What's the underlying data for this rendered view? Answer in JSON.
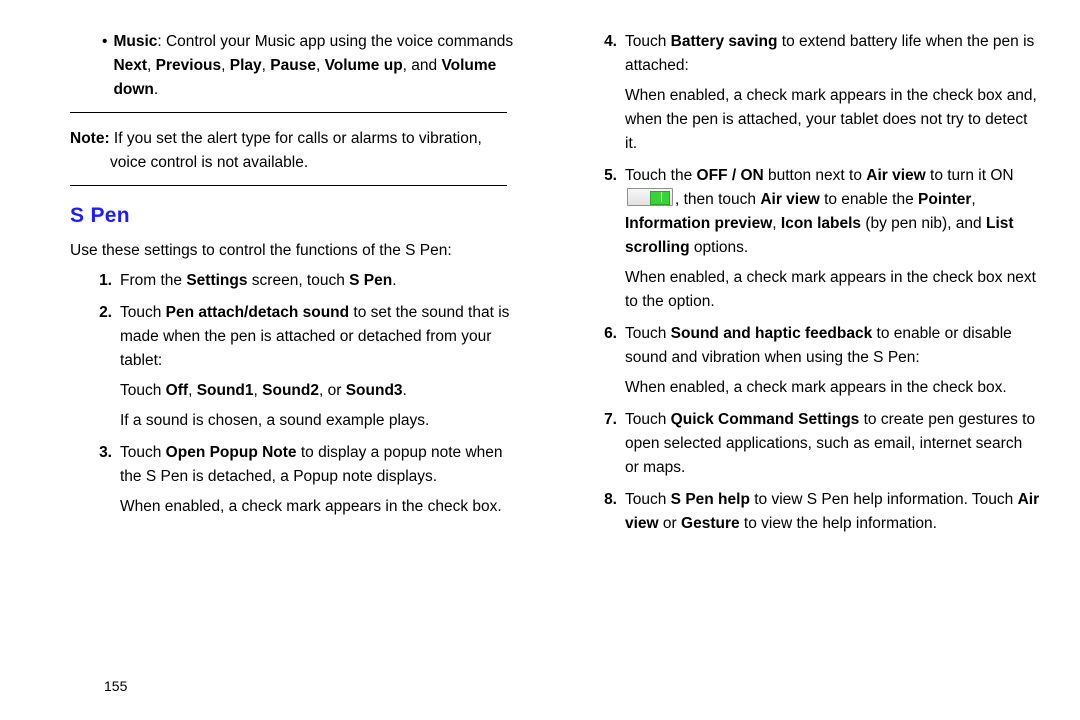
{
  "left": {
    "music_bullet_html": "<b>Music</b>: Control your Music app using the voice commands <b>Next</b>, <b>Previous</b>, <b>Play</b>, <b>Pause</b>, <b>Volume up</b>, and <b>Volume down</b>.",
    "note_line1_html": "<b>Note:</b> If you set the alert type for calls or alarms to vibration,",
    "note_line2": "voice control is not available.",
    "heading": "S Pen",
    "intro": "Use these settings to control the functions of the S Pen:",
    "steps": [
      {
        "n": "1.",
        "body": [
          "From the <b>Settings</b> screen, touch <b>S Pen</b>."
        ]
      },
      {
        "n": "2.",
        "body": [
          "Touch <b>Pen attach/detach sound</b> to set the sound that is made when the pen is attached or detached from your tablet:",
          "Touch <b>Off</b>, <b>Sound1</b>, <b>Sound2</b>, or <b>Sound3</b>.",
          "If a sound is chosen, a sound example plays."
        ]
      },
      {
        "n": "3.",
        "body": [
          "Touch <b>Open Popup Note</b> to display a popup note when the S Pen is detached, a Popup note displays.",
          "When enabled, a check mark appears in the check box."
        ]
      }
    ]
  },
  "right": {
    "steps": [
      {
        "n": "4.",
        "body": [
          "Touch <b>Battery saving</b> to extend battery life when the pen is attached:",
          "When enabled, a check mark appears in the check box and, when the pen is attached, your tablet does not try to detect it."
        ]
      },
      {
        "n": "5.",
        "body": [
          "Touch the <b>OFF / ON</b> button next to <b>Air view</b> to turn it ON {{SWITCH}}, then touch <b>Air view</b> to enable the <b>Pointer</b>, <b>Information preview</b>, <b>Icon labels</b> (by pen nib), and <b>List scrolling</b> options.",
          "When enabled, a check mark appears in the check box next to the option."
        ]
      },
      {
        "n": "6.",
        "body": [
          "Touch <b>Sound and haptic feedback</b> to enable or disable sound and vibration when using the S Pen:",
          "When enabled, a check mark appears in the check box."
        ]
      },
      {
        "n": "7.",
        "body": [
          "Touch <b>Quick Command Settings</b> to create pen gestures to open selected applications, such as email, internet search or maps."
        ]
      },
      {
        "n": "8.",
        "body": [
          "Touch <b>S Pen help</b> to view S Pen help information. Touch <b>Air view</b> or <b>Gesture</b> to view the help information."
        ]
      }
    ]
  },
  "page_number": "155"
}
